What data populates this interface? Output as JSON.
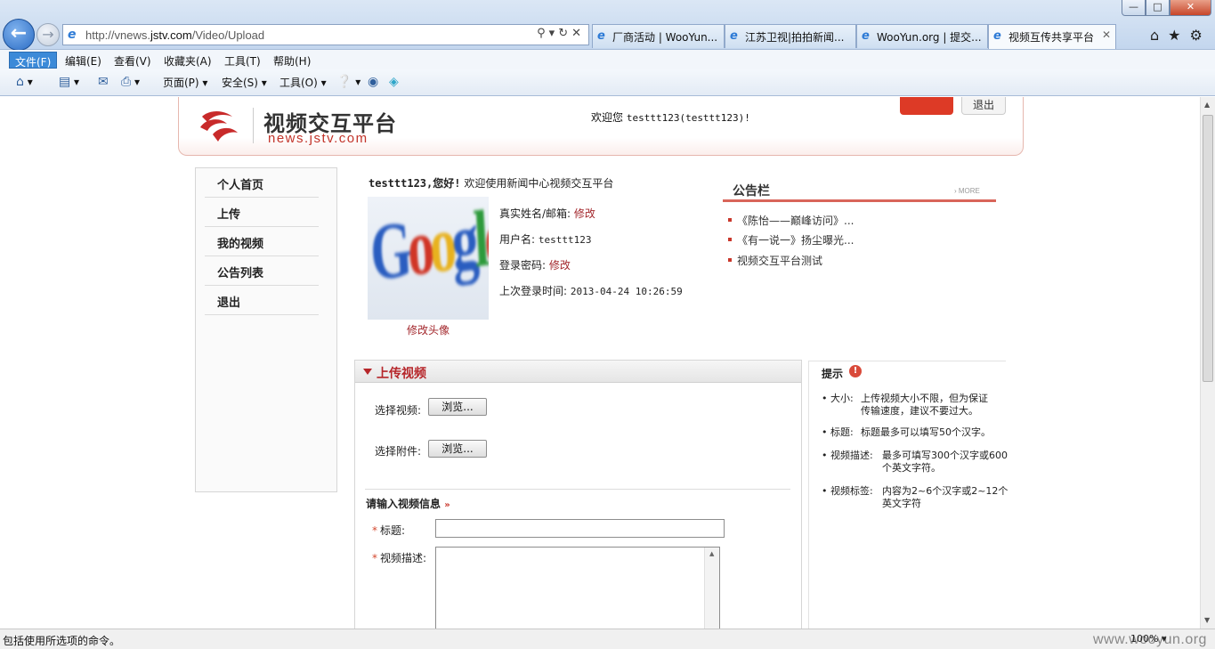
{
  "browser": {
    "address_host_prefix": "http://vnews.",
    "address_host_domain": "jstv.com",
    "address_path": "/Video/Upload",
    "tabs": [
      {
        "label": "厂商活动 | WooYun..."
      },
      {
        "label": "江苏卫视|拍拍新闻..."
      },
      {
        "label": "WooYun.org | 提交..."
      },
      {
        "label": "视频互传共享平台",
        "active": true
      }
    ],
    "menu": [
      "文件(F)",
      "编辑(E)",
      "查看(V)",
      "收藏夹(A)",
      "工具(T)",
      "帮助(H)"
    ],
    "commands": {
      "page": "页面(P)",
      "safety": "安全(S)",
      "tools": "工具(O)"
    },
    "status_text": "包括使用所选项的命令。",
    "zoom": "100%",
    "watermark": "www.wooyun.org"
  },
  "site": {
    "title": "视频交互平台",
    "subtitle": "news.jstv.com",
    "welcome_prefix": "欢迎您",
    "welcome_user": "testtt123(testtt123)!",
    "exit_label": "退出"
  },
  "sidebar": {
    "items": [
      {
        "label": "个人首页"
      },
      {
        "label": "上传"
      },
      {
        "label": "我的视频"
      },
      {
        "label": "公告列表"
      },
      {
        "label": "退出"
      }
    ]
  },
  "profile": {
    "greeting_name": "testtt123,您好!",
    "greeting_text": "欢迎使用新闻中心视频交互平台",
    "avatar_edit": "修改头像",
    "realname_label": "真实姓名/邮箱:",
    "realname_link": "修改",
    "username_label": "用户名:",
    "username_value": "testtt123",
    "password_label": "登录密码:",
    "password_link": "修改",
    "lastlogin_label": "上次登录时间:",
    "lastlogin_value": "2013-04-24 10:26:59"
  },
  "notice": {
    "title": "公告栏",
    "more": "› MORE",
    "items": [
      "《陈怡——巅峰访问》...",
      "《有一说一》扬尘曝光...",
      "视频交互平台测试"
    ]
  },
  "upload": {
    "title": "上传视频",
    "video_label": "选择视频:",
    "attach_label": "选择附件:",
    "browse_label": "浏览...",
    "info_heading": "请输入视频信息",
    "title_label": "标题:",
    "desc_label": "视频描述:"
  },
  "tips": {
    "title": "提示",
    "items": [
      {
        "key": "大小:",
        "value": "上传视频大小不限，但为保证传输速度，建议不要过大。"
      },
      {
        "key": "标题:",
        "value": "标题最多可以填写50个汉字。"
      },
      {
        "key": "视频描述:",
        "value": "最多可填写300个汉字或600个英文字符。"
      },
      {
        "key": "视频标签:",
        "value": "内容为2~6个汉字或2~12个英文字符"
      }
    ]
  }
}
